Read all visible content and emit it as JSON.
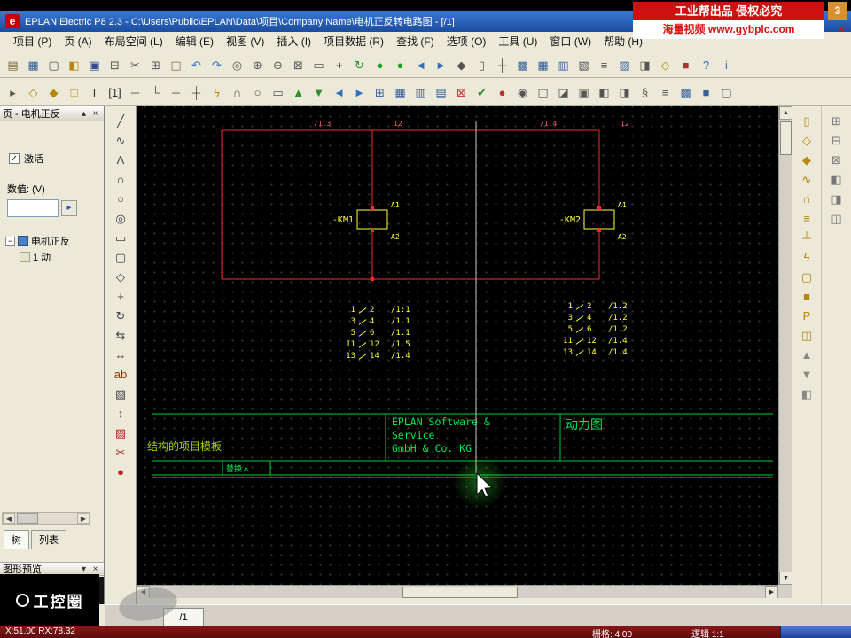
{
  "window": {
    "logo": "e",
    "title": "EPLAN Electric P8 2.3 - C:\\Users\\Public\\EPLAN\\Data\\项目\\Company Name\\电机正反转电路图 - [/1]",
    "badge": "3",
    "ad1": "工业帮出品 侵权必究",
    "ad2": "海量视频 www.gybplc.com"
  },
  "icons": {
    "close": "×",
    "panel_up": "▴",
    "panel_down": "▾",
    "scroll_up": "▲",
    "scroll_down": "▼",
    "scroll_left": "◀",
    "scroll_right": "▶",
    "play": "▸",
    "check": "✓",
    "expander": "−"
  },
  "menu": {
    "items": [
      "项目 (P)",
      "页 (A)",
      "布局空间 (L)",
      "编辑 (E)",
      "视图 (V)",
      "插入 (I)",
      "项目数据 (R)",
      "查找 (F)",
      "选项 (O)",
      "工具 (U)",
      "窗口 (W)",
      "帮助 (H)"
    ]
  },
  "toolbar1": [
    {
      "name": "page-icon",
      "glyph": "▤",
      "color": "#7a6a3a"
    },
    {
      "name": "navigator-icon",
      "glyph": "▦",
      "color": "#35629e"
    },
    {
      "name": "new-icon",
      "glyph": "▢",
      "color": "#555555"
    },
    {
      "name": "open-icon",
      "glyph": "◧",
      "color": "#b8860b"
    },
    {
      "name": "save-icon",
      "glyph": "▣",
      "color": "#2f4f8f"
    },
    {
      "name": "print-icon",
      "glyph": "⊟",
      "color": "#555555"
    },
    {
      "name": "cut-icon",
      "glyph": "✂",
      "color": "#555555"
    },
    {
      "name": "copy-icon",
      "glyph": "⊞",
      "color": "#555555"
    },
    {
      "name": "paste-icon",
      "glyph": "◫",
      "color": "#8a6d3b"
    },
    {
      "name": "undo-icon",
      "glyph": "↶",
      "color": "#2f6fbf"
    },
    {
      "name": "redo-icon",
      "glyph": "↷",
      "color": "#2f6fbf"
    },
    {
      "name": "find-icon",
      "glyph": "◎",
      "color": "#555555"
    },
    {
      "name": "zoom-in-icon",
      "glyph": "⊕",
      "color": "#555555"
    },
    {
      "name": "zoom-out-icon",
      "glyph": "⊖",
      "color": "#555555"
    },
    {
      "name": "zoom-window-icon",
      "glyph": "⊠",
      "color": "#555555"
    },
    {
      "name": "zoom-fit-icon",
      "glyph": "▭",
      "color": "#555555"
    },
    {
      "name": "pan-icon",
      "glyph": "+",
      "color": "#555555"
    },
    {
      "name": "redraw-icon",
      "glyph": "↻",
      "color": "#2f8f2f"
    },
    {
      "name": "back-icon",
      "glyph": "●",
      "color": "#1fa11f"
    },
    {
      "name": "forward-icon",
      "glyph": "●",
      "color": "#1fa11f"
    },
    {
      "name": "prev-page-icon",
      "glyph": "◄",
      "color": "#2f6fbf"
    },
    {
      "name": "next-page-icon",
      "glyph": "►",
      "color": "#2f6fbf"
    },
    {
      "name": "symbol-icon",
      "glyph": "◆",
      "color": "#555555"
    },
    {
      "name": "device-icon",
      "glyph": "▯",
      "color": "#555555"
    },
    {
      "name": "connection-icon",
      "glyph": "┼",
      "color": "#555555"
    },
    {
      "name": "grid-icon",
      "glyph": "▩",
      "color": "#35629e"
    },
    {
      "name": "table-icon",
      "glyph": "▦",
      "color": "#35629e"
    },
    {
      "name": "report-icon",
      "glyph": "▥",
      "color": "#35629e"
    },
    {
      "name": "parts-icon",
      "glyph": "▧",
      "color": "#555555"
    },
    {
      "name": "layers-icon",
      "glyph": "≡",
      "color": "#555555"
    },
    {
      "name": "graphic-icon",
      "glyph": "▨",
      "color": "#35629e"
    },
    {
      "name": "window-icon",
      "glyph": "◨",
      "color": "#555555"
    },
    {
      "name": "macro-icon",
      "glyph": "◇",
      "color": "#b8860b"
    },
    {
      "name": "plot-icon",
      "glyph": "■",
      "color": "#aa3333"
    },
    {
      "name": "help-icon",
      "glyph": "?",
      "color": "#2f6fbf"
    },
    {
      "name": "info-icon",
      "glyph": "i",
      "color": "#2f6fbf"
    }
  ],
  "toolbar2": [
    {
      "name": "select-icon",
      "glyph": "▸",
      "color": "#555555"
    },
    {
      "name": "insert-symbol-icon",
      "glyph": "◇",
      "color": "#b8860b"
    },
    {
      "name": "insert-macro-icon",
      "glyph": "◆",
      "color": "#b8860b"
    },
    {
      "name": "insert-box-icon",
      "glyph": "□",
      "color": "#b8860b"
    },
    {
      "name": "text-icon",
      "glyph": "T",
      "color": "#333333"
    },
    {
      "name": "layer-indicator",
      "glyph": "[1]",
      "color": "#333333"
    },
    {
      "name": "wire-icon",
      "glyph": "─",
      "color": "#555555"
    },
    {
      "name": "corner-icon",
      "glyph": "└",
      "color": "#555555"
    },
    {
      "name": "tnode-icon",
      "glyph": "┬",
      "color": "#555555"
    },
    {
      "name": "cross-icon",
      "glyph": "┼",
      "color": "#555555"
    },
    {
      "name": "interruption-icon",
      "glyph": "ϟ",
      "color": "#b8860b"
    },
    {
      "name": "arc-icon",
      "glyph": "∩",
      "color": "#555555"
    },
    {
      "name": "circle-icon",
      "glyph": "○",
      "color": "#555555"
    },
    {
      "name": "rect-icon",
      "glyph": "▭",
      "color": "#555555"
    },
    {
      "name": "up-icon",
      "glyph": "▲",
      "color": "#2f8f2f"
    },
    {
      "name": "down-icon",
      "glyph": "▼",
      "color": "#2f8f2f"
    },
    {
      "name": "left-icon",
      "glyph": "◄",
      "color": "#2f6fbf"
    },
    {
      "name": "right-icon",
      "glyph": "►",
      "color": "#2f6fbf"
    },
    {
      "name": "table-add-icon",
      "glyph": "⊞",
      "color": "#35629e"
    },
    {
      "name": "table2-icon",
      "glyph": "▦",
      "color": "#35629e"
    },
    {
      "name": "table3-icon",
      "glyph": "▥",
      "color": "#35629e"
    },
    {
      "name": "table4-icon",
      "glyph": "▤",
      "color": "#35629e"
    },
    {
      "name": "delete-icon",
      "glyph": "⊠",
      "color": "#c03030"
    },
    {
      "name": "ok-icon",
      "glyph": "✔",
      "color": "#2f8f2f"
    },
    {
      "name": "record-icon",
      "glyph": "●",
      "color": "#c03030"
    },
    {
      "name": "target-icon",
      "glyph": "◉",
      "color": "#555555"
    },
    {
      "name": "split-icon",
      "glyph": "◫",
      "color": "#555555"
    },
    {
      "name": "shade-icon",
      "glyph": "◪",
      "color": "#555555"
    },
    {
      "name": "fill-icon",
      "glyph": "▣",
      "color": "#555555"
    },
    {
      "name": "half-left-icon",
      "glyph": "◧",
      "color": "#555555"
    },
    {
      "name": "half-right-icon",
      "glyph": "◨",
      "color": "#555555"
    },
    {
      "name": "attrs-icon",
      "glyph": "§",
      "color": "#555555"
    },
    {
      "name": "list-icon",
      "glyph": "≡",
      "color": "#555555"
    },
    {
      "name": "dense-grid-icon",
      "glyph": "▩",
      "color": "#35629e"
    },
    {
      "name": "block-icon",
      "glyph": "■",
      "color": "#35629e"
    },
    {
      "name": "frame-icon",
      "glyph": "▢",
      "color": "#555555"
    }
  ],
  "tools_left": [
    {
      "name": "line-tool-icon",
      "glyph": "╱",
      "color": "#444444"
    },
    {
      "name": "spline-tool-icon",
      "glyph": "∿",
      "color": "#444444"
    },
    {
      "name": "polyline-tool-icon",
      "glyph": "Λ",
      "color": "#444444"
    },
    {
      "name": "arc-tool-icon",
      "glyph": "∩",
      "color": "#444444"
    },
    {
      "name": "circle-tool-icon",
      "glyph": "○",
      "color": "#444444"
    },
    {
      "name": "ellipse-tool-icon",
      "glyph": "◎",
      "color": "#444444"
    },
    {
      "name": "rectangle-tool-icon",
      "glyph": "▭",
      "color": "#444444"
    },
    {
      "name": "rounded-rect-tool-icon",
      "glyph": "▢",
      "color": "#444444"
    },
    {
      "name": "polygon-tool-icon",
      "glyph": "◇",
      "color": "#444444"
    },
    {
      "name": "move-tool-icon",
      "glyph": "+",
      "color": "#444444"
    },
    {
      "name": "rotate-tool-icon",
      "glyph": "↻",
      "color": "#444444"
    },
    {
      "name": "mirror-tool-icon",
      "glyph": "⇆",
      "color": "#444444"
    },
    {
      "name": "stretch-tool-icon",
      "glyph": "↔",
      "color": "#444444"
    },
    {
      "name": "text-tool-icon",
      "glyph": "ab",
      "color": "#993300"
    },
    {
      "name": "hatch-tool-icon",
      "glyph": "▧",
      "color": "#444444"
    },
    {
      "name": "dimension-tool-icon",
      "glyph": "↕",
      "color": "#444444"
    },
    {
      "name": "image-tool-icon",
      "glyph": "▨",
      "color": "#b22222"
    },
    {
      "name": "trim-tool-icon",
      "glyph": "✂",
      "color": "#b22222"
    },
    {
      "name": "dot-tool-icon",
      "glyph": "●",
      "color": "#b22222"
    }
  ],
  "tools_right": [
    {
      "name": "insert-device-icon",
      "glyph": "▯",
      "color": "#b8860b"
    },
    {
      "name": "insert-terminal-icon",
      "glyph": "◇",
      "color": "#b8860b"
    },
    {
      "name": "insert-plug-icon",
      "glyph": "◆",
      "color": "#b8860b"
    },
    {
      "name": "insert-cable-icon",
      "glyph": "∿",
      "color": "#b8860b"
    },
    {
      "name": "insert-shield-icon",
      "glyph": "∩",
      "color": "#b8860b"
    },
    {
      "name": "insert-busbar-icon",
      "glyph": "≡",
      "color": "#b8860b"
    },
    {
      "name": "potential-icon",
      "glyph": "┴",
      "color": "#b8860b"
    },
    {
      "name": "interruption-point-icon",
      "glyph": "ϟ",
      "color": "#b8860b"
    },
    {
      "name": "structure-box-icon",
      "glyph": "▢",
      "color": "#b8860b"
    },
    {
      "name": "black-box-icon",
      "glyph": "■",
      "color": "#b8860b"
    },
    {
      "name": "plc-box-icon",
      "glyph": "P",
      "color": "#b8860b"
    },
    {
      "name": "macro-box-icon",
      "glyph": "◫",
      "color": "#b8860b"
    },
    {
      "name": "up-small-icon",
      "glyph": "▲",
      "color": "#888888"
    },
    {
      "name": "down-small-icon",
      "glyph": "▼",
      "color": "#888888"
    },
    {
      "name": "dock-icon",
      "glyph": "◧",
      "color": "#888888"
    }
  ],
  "tools_far": [
    {
      "name": "dock-grid-icon",
      "glyph": "⊞",
      "color": "#777777"
    },
    {
      "name": "dock-minus-icon",
      "glyph": "⊟",
      "color": "#777777"
    },
    {
      "name": "dock-close-icon",
      "glyph": "⊠",
      "color": "#777777"
    },
    {
      "name": "dock-left-icon",
      "glyph": "◧",
      "color": "#777777"
    },
    {
      "name": "dock-right-icon",
      "glyph": "◨",
      "color": "#777777"
    },
    {
      "name": "dock-split-icon",
      "glyph": "◫",
      "color": "#777777"
    }
  ],
  "panel": {
    "title": "页 - 电机正反",
    "activate": "激活",
    "value_label": "数值: (V)",
    "value": "",
    "tabs": [
      "树",
      "列表"
    ],
    "preview_title": "图形预览",
    "tree_root": "电机正反",
    "tree_child": "1 动"
  },
  "canvas": {
    "refs_top": [
      "/1.3",
      "12",
      "/1.4",
      "12"
    ],
    "km1": "-KM1",
    "km2": "-KM2",
    "a1": "A1",
    "a2": "A2",
    "contacts_left": [
      {
        "p1": "1",
        "p2": "2",
        "ref": "/1:1"
      },
      {
        "p1": "3",
        "p2": "4",
        "ref": "/1.1"
      },
      {
        "p1": "5",
        "p2": "6",
        "ref": "/1.1"
      },
      {
        "p1": "11",
        "p2": "12",
        "ref": "/1.5"
      },
      {
        "p1": "13",
        "p2": "14",
        "ref": "/1.4"
      }
    ],
    "contacts_right": [
      {
        "p1": "1",
        "p2": "2",
        "ref": "/1.2"
      },
      {
        "p1": "3",
        "p2": "4",
        "ref": "/1.2"
      },
      {
        "p1": "5",
        "p2": "6",
        "ref": "/1.2"
      },
      {
        "p1": "11",
        "p2": "12",
        "ref": "/1.4"
      },
      {
        "p1": "13",
        "p2": "14",
        "ref": "/1.4"
      }
    ],
    "block": {
      "line1": "EPLAN Software &",
      "line2": "Service",
      "line3": "GmbH & Co. KG",
      "name": "动力图",
      "template": "结构的项目模板",
      "substitute": "替换人"
    }
  },
  "bottom": {
    "tab": "/1"
  },
  "status": {
    "left": "X:51.00  RX:78.32",
    "grid": "栅格: 4.00",
    "logic": "逻辑 1:1"
  },
  "watermark": {
    "text": "工控圈"
  }
}
